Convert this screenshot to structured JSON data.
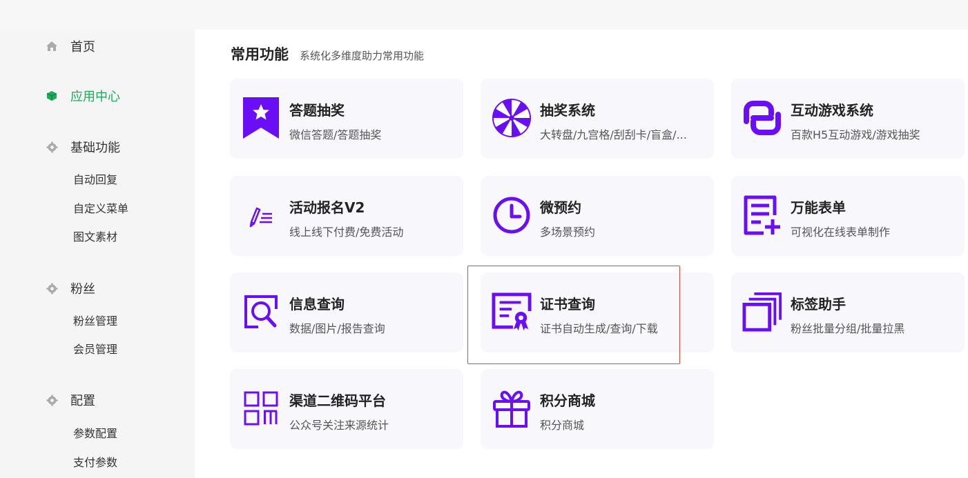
{
  "sidebar": {
    "home": "首页",
    "app_center": "应用中心",
    "basic": {
      "label": "基础功能",
      "items": [
        "自动回复",
        "自定义菜单",
        "图文素材"
      ]
    },
    "fans": {
      "label": "粉丝",
      "items": [
        "粉丝管理",
        "会员管理"
      ]
    },
    "config": {
      "label": "配置",
      "items": [
        "参数配置",
        "支付参数"
      ]
    }
  },
  "main": {
    "title": "常用功能",
    "subtitle": "系统化多维度助力常用功能",
    "cards": [
      {
        "title": "答题抽奖",
        "desc": "微信答题/答题抽奖"
      },
      {
        "title": "抽奖系统",
        "desc": "大转盘/九宫格/刮刮卡/盲盒/..."
      },
      {
        "title": "互动游戏系统",
        "desc": "百款H5互动游戏/游戏抽奖"
      },
      {
        "title": "活动报名V2",
        "desc": "线上线下付费/免费活动"
      },
      {
        "title": "微预约",
        "desc": "多场景预约"
      },
      {
        "title": "万能表单",
        "desc": "可视化在线表单制作"
      },
      {
        "title": "信息查询",
        "desc": "数据/图片/报告查询"
      },
      {
        "title": "证书查询",
        "desc": "证书自动生成/查询/下载"
      },
      {
        "title": "标签助手",
        "desc": "粉丝批量分组/批量拉黑"
      },
      {
        "title": "渠道二维码平台",
        "desc": "公众号关注来源统计"
      },
      {
        "title": "积分商城",
        "desc": "积分商城"
      }
    ]
  },
  "colors": {
    "accent": "#6a0ff5",
    "active_nav": "#1aad5a",
    "highlight": "#e0423c"
  },
  "icons": {
    "home": "home-icon",
    "app_center": "cube-icon",
    "settings": "gear-icon"
  }
}
